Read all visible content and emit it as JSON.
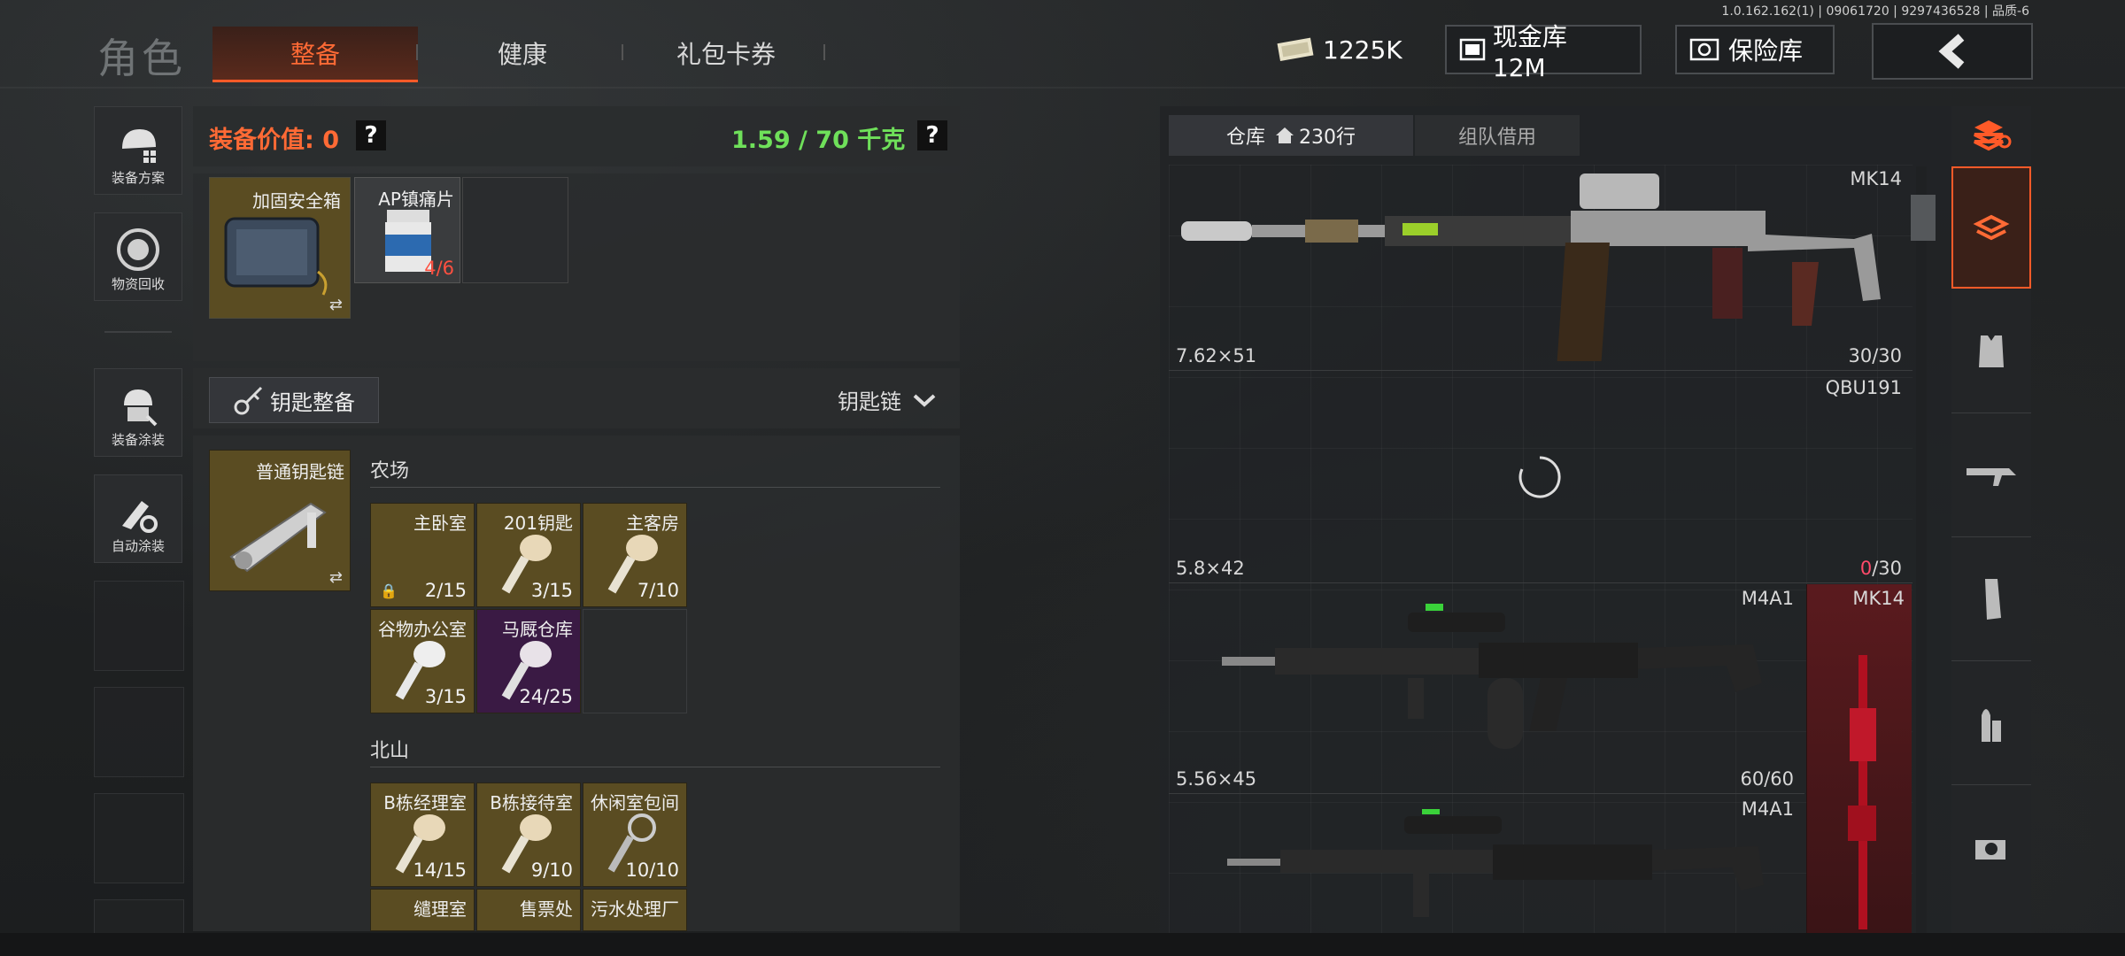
{
  "version": "1.0.162.162(1) | 09061720 | 9297436528 | 品质-6",
  "header": {
    "title": "角色",
    "tabs": [
      {
        "label": "整备"
      },
      {
        "label": "健康"
      },
      {
        "label": "礼包卡券"
      }
    ],
    "currency": "1225K",
    "cash_vault": "现金库 12M",
    "safe": "保险库"
  },
  "sidebar": {
    "items": [
      {
        "label": "装备方案"
      },
      {
        "label": "物资回收"
      },
      {
        "label": "装备涂装"
      },
      {
        "label": "自动涂装"
      }
    ]
  },
  "equipment": {
    "value_label": "装备价值: 0",
    "weight": "1.59 / 70 千克",
    "help": "?",
    "items": [
      {
        "name": "加固安全箱"
      },
      {
        "name": "AP镇痛片",
        "count": "4/6"
      }
    ]
  },
  "keys": {
    "button": "钥匙整备",
    "dropdown": "钥匙链",
    "keychain": "普通钥匙链",
    "groups": [
      {
        "name": "农场",
        "keys": [
          {
            "name": "主卧室",
            "count": "2/15"
          },
          {
            "name": "201钥匙",
            "count": "3/15"
          },
          {
            "name": "主客房",
            "count": "7/10"
          },
          {
            "name": "谷物办公室",
            "count": "3/15"
          },
          {
            "name": "马厩仓库",
            "count": "24/25"
          }
        ]
      },
      {
        "name": "北山",
        "keys": [
          {
            "name": "B栋经理室",
            "count": "14/15"
          },
          {
            "name": "B栋接待室",
            "count": "9/10"
          },
          {
            "name": "休闲室包间",
            "count": "10/10"
          },
          {
            "name": "缱理室",
            "count": ""
          },
          {
            "name": "售票处",
            "count": ""
          },
          {
            "name": "污水处理厂",
            "count": ""
          }
        ]
      }
    ]
  },
  "warehouse": {
    "tabs": [
      {
        "label": "仓库"
      },
      {
        "label": "230行"
      },
      {
        "label": "组队借用"
      }
    ],
    "weapons": [
      {
        "name": "MK14",
        "caliber": "7.62×51",
        "ammo": "30/30"
      },
      {
        "name": "QBU191",
        "caliber": "5.8×42",
        "ammo_current": "0",
        "ammo_max": "/30"
      },
      {
        "name": "M4A1",
        "caliber": "5.56×45",
        "ammo": "60/60"
      },
      {
        "name": "M4A1",
        "caliber": "",
        "ammo": ""
      }
    ],
    "side_item": "MK14"
  },
  "colors": {
    "accent": "#ff5a28",
    "weight": "#6fe05a",
    "value": "#ff6a35"
  }
}
